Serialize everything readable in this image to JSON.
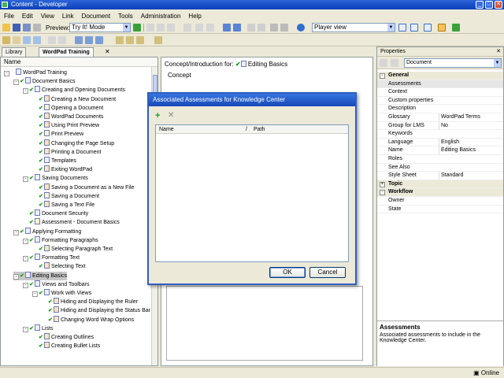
{
  "window": {
    "title": "Content - Developer",
    "minimize": "_",
    "maximize": "□",
    "close": "✕"
  },
  "menu": [
    "File",
    "Edit",
    "View",
    "Link",
    "Document",
    "Tools",
    "Administration",
    "Help"
  ],
  "toolbar": {
    "preview_label": "Preview:",
    "preview_mode": "Try It! Mode",
    "player_view": "Player view",
    "combo_arrow": "▼"
  },
  "left": {
    "tabs": [
      {
        "label": "Library"
      },
      {
        "label": "WordPad Training"
      }
    ],
    "tab_close": "✕",
    "column_header": "Name",
    "tree": [
      {
        "label": "WordPad Training",
        "depth": 0,
        "expander": "-",
        "check": "",
        "icon": "book"
      },
      {
        "label": "Document Basics",
        "depth": 1,
        "expander": "-",
        "check": "✔",
        "icon": "book"
      },
      {
        "label": "Creating and Opening Documents",
        "depth": 2,
        "expander": "-",
        "check": "✔",
        "icon": "book"
      },
      {
        "label": "Creating a New Document",
        "depth": 3,
        "expander": "",
        "check": "✔",
        "icon": "topic"
      },
      {
        "label": "Opening a Document",
        "depth": 3,
        "expander": "",
        "check": "✔",
        "icon": "help"
      },
      {
        "label": "WordPad Documents",
        "depth": 3,
        "expander": "",
        "check": "✔",
        "icon": "topic"
      },
      {
        "label": "Using Print Preview",
        "depth": 3,
        "expander": "",
        "check": "✔",
        "icon": "topic"
      },
      {
        "label": "Print Preview",
        "depth": 3,
        "expander": "",
        "check": "✔",
        "icon": "help"
      },
      {
        "label": "Changing the Page Setup",
        "depth": 3,
        "expander": "",
        "check": "✔",
        "icon": "topic"
      },
      {
        "label": "Printing a Document",
        "depth": 3,
        "expander": "",
        "check": "✔",
        "icon": "topic"
      },
      {
        "label": "Templates",
        "depth": 3,
        "expander": "",
        "check": "✔",
        "icon": "doc"
      },
      {
        "label": "Exiting WordPad",
        "depth": 3,
        "expander": "",
        "check": "✔",
        "icon": "topic"
      },
      {
        "label": "Saving Documents",
        "depth": 2,
        "expander": "-",
        "check": "✔",
        "icon": "book"
      },
      {
        "label": "Saving a Document as a New File",
        "depth": 3,
        "expander": "",
        "check": "✔",
        "icon": "topic"
      },
      {
        "label": "Saving a Document",
        "depth": 3,
        "expander": "",
        "check": "✔",
        "icon": "help"
      },
      {
        "label": "Saving a Text File",
        "depth": 3,
        "expander": "",
        "check": "✔",
        "icon": "topic"
      },
      {
        "label": "Document Security",
        "depth": 2,
        "expander": "",
        "check": "✔",
        "icon": "doc"
      },
      {
        "label": "Assessment - Document Basics",
        "depth": 2,
        "expander": "",
        "check": "✔",
        "icon": "help"
      },
      {
        "label": "Applying Formatting",
        "depth": 1,
        "expander": "-",
        "check": "✔",
        "icon": "book"
      },
      {
        "label": "Formatting Paragraphs",
        "depth": 2,
        "expander": "-",
        "check": "✔",
        "icon": "book"
      },
      {
        "label": "Selecting Paragraph Text",
        "depth": 3,
        "expander": "",
        "check": "✔",
        "icon": "topic"
      },
      {
        "label": "Formatting Text",
        "depth": 2,
        "expander": "-",
        "check": "✔",
        "icon": "book"
      },
      {
        "label": "Selecting Text",
        "depth": 3,
        "expander": "",
        "check": "✔",
        "icon": "topic"
      },
      {
        "label": "Editing Basics",
        "depth": 1,
        "expander": "-",
        "check": "✔",
        "icon": "book",
        "selected": true
      },
      {
        "label": "Views and Toolbars",
        "depth": 2,
        "expander": "-",
        "check": "✔",
        "icon": "book"
      },
      {
        "label": "Work with Views",
        "depth": 3,
        "expander": "-",
        "check": "✔",
        "icon": "book"
      },
      {
        "label": "Hiding and Displaying the Ruler",
        "depth": 4,
        "expander": "",
        "check": "✔",
        "icon": "topic"
      },
      {
        "label": "Hiding and Displaying the Status Bar",
        "depth": 4,
        "expander": "",
        "check": "✔",
        "icon": "topic"
      },
      {
        "label": "Changing Word Wrap Options",
        "depth": 4,
        "expander": "",
        "check": "✔",
        "icon": "topic"
      },
      {
        "label": "Lists",
        "depth": 2,
        "expander": "-",
        "check": "✔",
        "icon": "book"
      },
      {
        "label": "Creating Outlines",
        "depth": 3,
        "expander": "",
        "check": "✔",
        "icon": "topic"
      },
      {
        "label": "Creating Bullet Lists",
        "depth": 3,
        "expander": "",
        "check": "✔",
        "icon": "topic"
      }
    ]
  },
  "center": {
    "concept_for": "Concept/Introduction for:",
    "concept_item": "Editing Basics",
    "concept_tab": "Concept"
  },
  "properties": {
    "title": "Properties",
    "close": "✕",
    "combo_value": "Document",
    "combo_arrow": "▼",
    "rows": [
      {
        "type": "cat",
        "key": "General",
        "pm": "-"
      },
      {
        "type": "row",
        "key": "Assessments",
        "value": "",
        "highlight": true
      },
      {
        "type": "row",
        "key": "Context",
        "value": ""
      },
      {
        "type": "row",
        "key": "Custom properties",
        "value": ""
      },
      {
        "type": "row",
        "key": "Description",
        "value": ""
      },
      {
        "type": "row",
        "key": "Glossary",
        "value": "WordPad Terms"
      },
      {
        "type": "row",
        "key": "Group for LMS",
        "value": "No"
      },
      {
        "type": "row",
        "key": "Keywords",
        "value": ""
      },
      {
        "type": "row",
        "key": "Language",
        "value": "English"
      },
      {
        "type": "row",
        "key": "Name",
        "value": "Editing Basics"
      },
      {
        "type": "row",
        "key": "Roles",
        "value": ""
      },
      {
        "type": "row",
        "key": "See Also",
        "value": ""
      },
      {
        "type": "row",
        "key": "Style Sheet",
        "value": "Standard"
      },
      {
        "type": "cat",
        "key": "Topic",
        "pm": "+"
      },
      {
        "type": "cat",
        "key": "Workflow",
        "pm": "-"
      },
      {
        "type": "row",
        "key": "Owner",
        "value": ""
      },
      {
        "type": "row",
        "key": "State",
        "value": ""
      }
    ],
    "desc_title": "Assessments",
    "desc_body": "Associated assessments to include in the Knowledge Center."
  },
  "dialog": {
    "title": "Associated Assessments for Knowledge Center",
    "add_icon": "+",
    "delete_icon": "✕",
    "col_name": "Name",
    "col_sep": "/",
    "col_path": "Path",
    "ok": "OK",
    "cancel": "Cancel"
  },
  "status": {
    "online": "Online"
  }
}
